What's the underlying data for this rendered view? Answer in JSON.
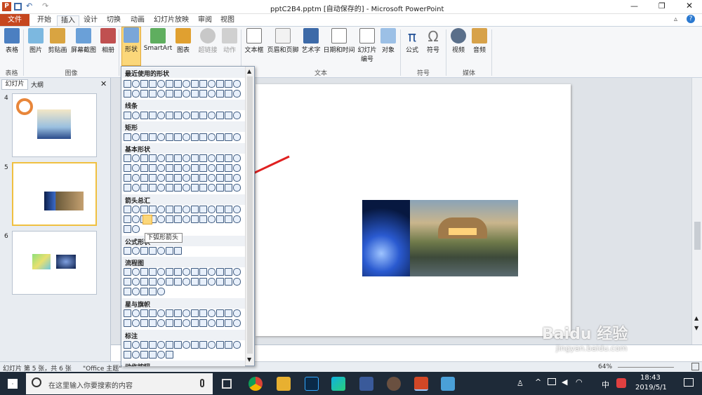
{
  "titlebar": {
    "title": "pptC2B4.pptm [自动保存的] - Microsoft PowerPoint"
  },
  "tabs": {
    "file": "文件",
    "home": "开始",
    "insert": "插入",
    "design": "设计",
    "transitions": "切换",
    "animations": "动画",
    "slideshow": "幻灯片放映",
    "review": "审阅",
    "view": "视图"
  },
  "ribbon": {
    "table": "表格",
    "picture": "图片",
    "clipart": "剪贴画",
    "screenshot": "屏幕截图",
    "album": "相册",
    "shapes": "形状",
    "smartart": "SmartArt",
    "chart": "图表",
    "hyperlink": "超链接",
    "action": "动作",
    "textbox": "文本框",
    "headerfooter": "页眉和页脚",
    "wordart": "艺术字",
    "datetime": "日期和时间",
    "slidenum": "幻灯片编号",
    "object": "对象",
    "equation": "公式",
    "symbol": "符号",
    "video": "视频",
    "audio": "音频",
    "groups": {
      "table": "表格",
      "images": "图像",
      "text": "文本",
      "symbols": "符号",
      "media": "媒体"
    }
  },
  "panel": {
    "tab_slides": "幻灯片",
    "tab_outline": "大纲",
    "slides": [
      "4",
      "5",
      "6"
    ]
  },
  "shapes_gallery": {
    "sections": [
      "最近使用的形状",
      "线条",
      "矩形",
      "基本形状",
      "箭头总汇",
      "公式形状",
      "流程图",
      "星与旗帜",
      "标注",
      "动作按钮"
    ],
    "tooltip": "下弧形箭头"
  },
  "status": {
    "slide_info": "幻灯片 第 5 张，共 6 张",
    "theme": "\"Office 主题\"",
    "zoom": "64%"
  },
  "taskbar": {
    "search_placeholder": "在这里输入你要搜索的内容",
    "time": "18:43",
    "date": "2019/5/1",
    "ime": "中"
  },
  "watermark": {
    "brand": "Baidu 经验",
    "url": "jingyan.baidu.com"
  },
  "colors": {
    "file_tab": "#c6471f",
    "accent": "#2b579a",
    "arrow": "#e02020",
    "taskbar": "#1e2a38"
  }
}
